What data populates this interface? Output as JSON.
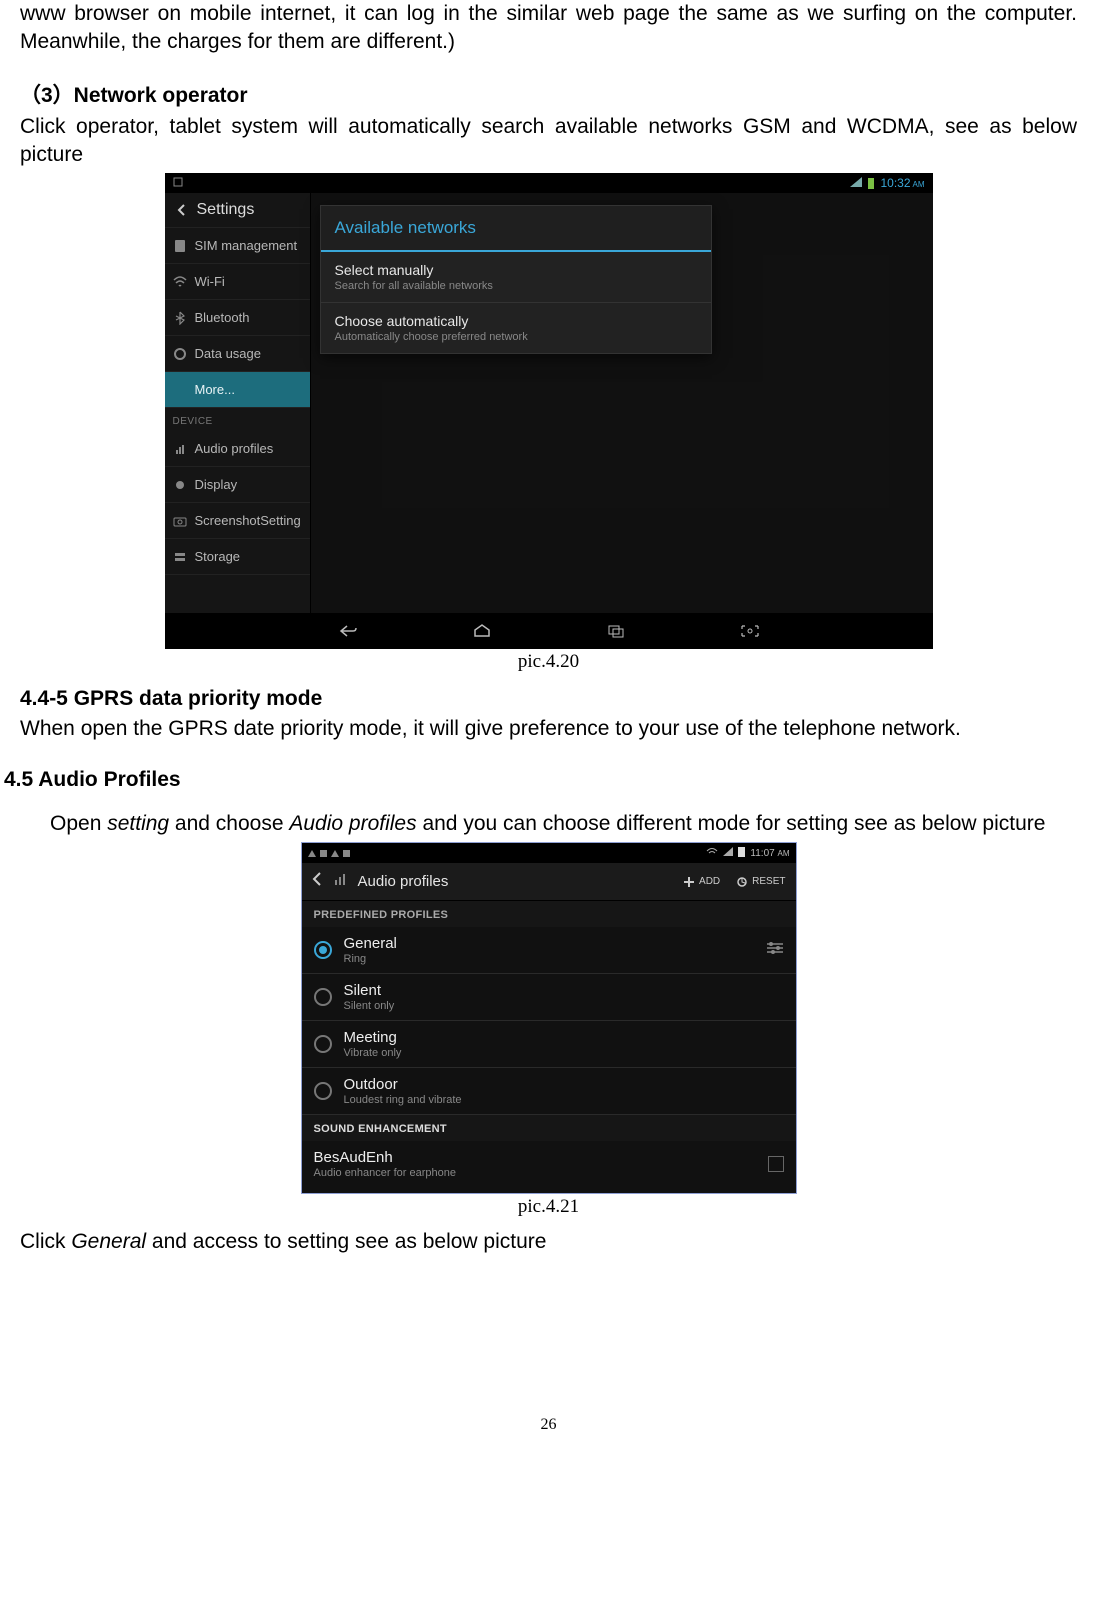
{
  "paragraphs": {
    "intro_cont": "www browser on mobile internet, it can log in the similar web page the same as we surfing on the computer. Meanwhile, the charges for them are different.)",
    "net_op_heading": "（3）Network operator",
    "net_op_text": "Click operator, tablet system will automatically search available networks GSM and WCDMA, see as below picture",
    "gprs_heading": "4.4-5 GPRS data priority mode",
    "gprs_text": "When open the GPRS date priority mode, it will give preference to your use of the telephone network.",
    "audio_heading": "4.5 Audio Profiles",
    "audio_text_pre": "Open ",
    "audio_text_i1": "setting",
    "audio_text_mid": " and choose ",
    "audio_text_i2": "Audio profiles",
    "audio_text_post": " and you can choose different mode for setting see as below picture",
    "click_general_pre": "Click ",
    "click_general_i": "General",
    "click_general_post": " and access to setting see as below picture"
  },
  "captions": {
    "c1": "pic.4.20",
    "c2": "pic.4.21"
  },
  "page_number": "26",
  "screenshot1": {
    "status_time": "10:32",
    "status_ampm": "AM",
    "back_label": "Settings",
    "sidebar": {
      "items": [
        {
          "label": "SIM management",
          "icon": "sim"
        },
        {
          "label": "Wi-Fi",
          "icon": "wifi"
        },
        {
          "label": "Bluetooth",
          "icon": "bt"
        },
        {
          "label": "Data usage",
          "icon": "data"
        },
        {
          "label": "More...",
          "icon": "",
          "selected": true
        }
      ],
      "category": "DEVICE",
      "items2": [
        {
          "label": "Audio profiles",
          "icon": "audio"
        },
        {
          "label": "Display",
          "icon": "display"
        },
        {
          "label": "ScreenshotSetting",
          "icon": "camera"
        },
        {
          "label": "Storage",
          "icon": "storage"
        }
      ]
    },
    "dialog": {
      "title": "Available networks",
      "items": [
        {
          "title": "Select manually",
          "subtitle": "Search for all available networks"
        },
        {
          "title": "Choose automatically",
          "subtitle": "Automatically choose preferred network"
        }
      ]
    }
  },
  "screenshot2": {
    "status_time": "11:07",
    "status_ampm": "AM",
    "title": "Audio profiles",
    "add_label": "ADD",
    "reset_label": "RESET",
    "section1": "PREDEFINED PROFILES",
    "profiles": [
      {
        "title": "General",
        "subtitle": "Ring",
        "selected": true,
        "trailing": "tune"
      },
      {
        "title": "Silent",
        "subtitle": "Silent only",
        "selected": false
      },
      {
        "title": "Meeting",
        "subtitle": "Vibrate only",
        "selected": false
      },
      {
        "title": "Outdoor",
        "subtitle": "Loudest ring and vibrate",
        "selected": false
      }
    ],
    "section2": "SOUND ENHANCEMENT",
    "enhancement": {
      "title": "BesAudEnh",
      "subtitle": "Audio enhancer for earphone"
    }
  }
}
